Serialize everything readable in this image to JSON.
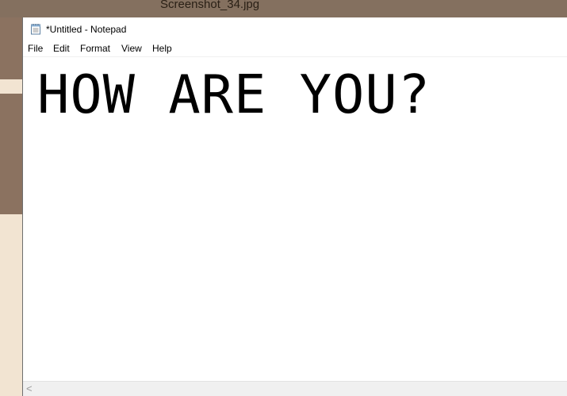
{
  "background": {
    "file_title": "Screenshot_34.jpg"
  },
  "window": {
    "title": "*Untitled - Notepad",
    "icon": "notepad-icon"
  },
  "menu": {
    "items": [
      "File",
      "Edit",
      "Format",
      "View",
      "Help"
    ]
  },
  "editor": {
    "content": "HOW ARE YOU?"
  },
  "scrollbar": {
    "left_arrow": "<"
  },
  "colors": {
    "desktop_brown": "#8b7260",
    "desktop_light": "#f2e4d2",
    "window_bg": "#ffffff",
    "scrollbar_bg": "#f0f0f0"
  }
}
